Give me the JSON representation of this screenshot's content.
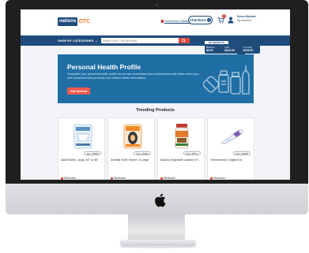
{
  "header": {
    "logo_box": "nations",
    "logo_text": "OTC",
    "download_catalog": "Download Catalog",
    "checkout_label": "Checkout",
    "cart_count": "0",
    "member_name": "Demo Member",
    "member_sub": "My Account"
  },
  "nav": {
    "categories_label": "SHOP BY CATEGORIES",
    "search_placeholder": "Search over 1,500 products"
  },
  "benefits": {
    "tab_label": "MY BENEFITS",
    "items": [
      {
        "label": "Balance",
        "amount": "$0.00"
      },
      {
        "label": "Cart",
        "amount": "$244.00"
      },
      {
        "label": "You Pay",
        "amount": "$233.00"
      }
    ]
  },
  "hero": {
    "title": "Personal Health Profile",
    "body": "Complete your personal health profile so we can understand your preferences and better serve you with recommended products and related health information.",
    "button_label": "Get Started"
  },
  "trending": {
    "title": "Trending Products",
    "products": [
      {
        "item": "Item: #8854",
        "name": "Adult Briefs, Large, 48\" to 58\"",
        "plan": "Medicare"
      },
      {
        "item": "Item: #8429",
        "name": "Arthritis Knee Sleeve, X-Large",
        "plan": "Medicare"
      },
      {
        "item": "Item: #8637",
        "name": "Natural Vegetable Laxative (F...",
        "plan": "Medicare"
      },
      {
        "item": "Item: #8648",
        "name": "Thermometer, Digital Ear",
        "plan": "Medicare"
      }
    ]
  },
  "colors": {
    "brand_navy": "#1f4c7b",
    "brand_orange": "#f47b20",
    "hero_blue": "#1f6fa5",
    "cta_red": "#f0594b"
  },
  "icons": [
    "search-icon",
    "cart-icon",
    "user-icon",
    "arrow-right-icon",
    "apple-logo",
    "pdf-icon"
  ]
}
